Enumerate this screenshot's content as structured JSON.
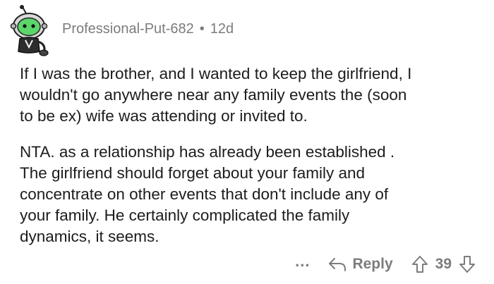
{
  "comment": {
    "author": "Professional-Put-682",
    "separator": "•",
    "age": "12d",
    "paragraphs": [
      "If I was the brother, and I wanted to keep the girlfriend, I\nwouldn't go anywhere near any family events the (soon\nto be ex) wife was attending or invited to.",
      "NTA. as a relationship has already been established .\nThe girlfriend should forget about your family and\nconcentrate on other events that don't include any of\nyour family.  He certainly complicated the family\ndynamics, it seems."
    ]
  },
  "actions": {
    "more_label": "...",
    "reply_label": "Reply",
    "vote_count": "39"
  },
  "icons": {
    "reply": "reply-arrow-icon",
    "upvote": "upvote-arrow-icon",
    "downvote": "downvote-arrow-icon",
    "avatar": "snoo-avatar"
  },
  "colors": {
    "meta_text": "#7c7c7c",
    "body_text": "#1c1c1c",
    "avatar_green": "#5bd66a"
  }
}
